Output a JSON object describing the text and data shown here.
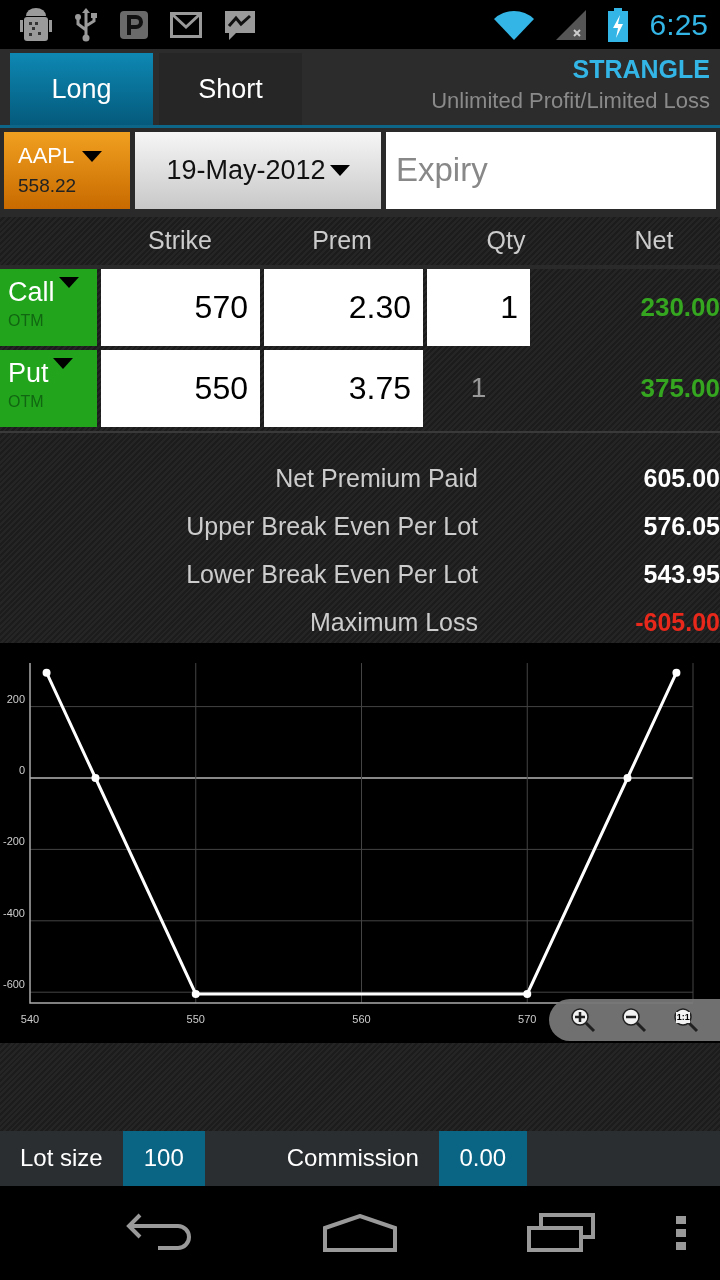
{
  "status_bar": {
    "time": "6:25"
  },
  "tabs": [
    {
      "label": "Long",
      "selected": true
    },
    {
      "label": "Short",
      "selected": false
    }
  ],
  "strategy": {
    "name": "STRANGLE",
    "description": "Unlimited Profit/Limited Loss"
  },
  "symbol": {
    "ticker": "AAPL",
    "price": "558.22"
  },
  "date": "19-May-2012",
  "expiry": {
    "placeholder": "Expiry"
  },
  "columns": [
    "Strike",
    "Prem",
    "Qty",
    "Net"
  ],
  "legs": [
    {
      "type": "Call",
      "moneyness": "OTM",
      "strike": "570",
      "premium": "2.30",
      "qty": "1",
      "qty_editable": true,
      "net": "230.00"
    },
    {
      "type": "Put",
      "moneyness": "OTM",
      "strike": "550",
      "premium": "3.75",
      "qty": "1",
      "qty_editable": false,
      "net": "375.00"
    }
  ],
  "summary": [
    {
      "label": "Net Premium Paid",
      "value": "605.00",
      "kind": "normal"
    },
    {
      "label": "Upper Break Even Per Lot",
      "value": "576.05",
      "kind": "normal"
    },
    {
      "label": "Lower Break Even Per Lot",
      "value": "543.95",
      "kind": "normal"
    },
    {
      "label": "Maximum Loss",
      "value": "-605.00",
      "kind": "loss"
    }
  ],
  "chart": {
    "chart_data": {
      "type": "line",
      "x": [
        541,
        543.95,
        550,
        570,
        576.05,
        579
      ],
      "series": [
        {
          "color": "#ffffff",
          "marker": true,
          "values": [
            295,
            0,
            -605,
            -605,
            0,
            295
          ]
        }
      ],
      "xlim": [
        540,
        580
      ],
      "ylim": [
        -630,
        322
      ],
      "xticks": [
        540,
        550,
        560,
        570
      ],
      "yticks": [
        200,
        0,
        -200,
        -400,
        -600
      ],
      "grid": true
    },
    "zoom_reset_label": "1:1"
  },
  "settings": {
    "lot_size_label": "Lot size",
    "lot_size": "100",
    "commission_label": "Commission",
    "commission": "0.00"
  }
}
